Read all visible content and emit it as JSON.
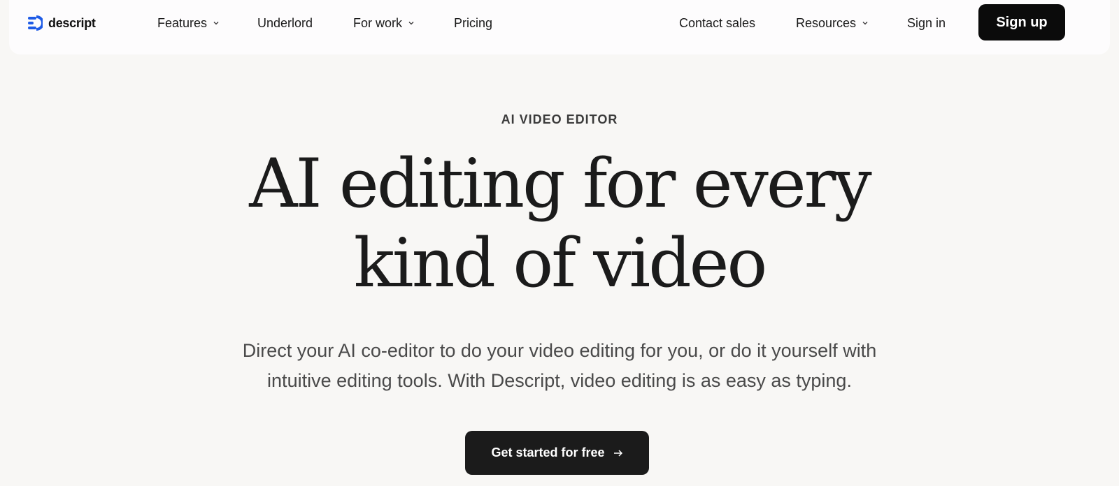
{
  "brand": {
    "name": "descript",
    "color": "#1e5be6"
  },
  "nav": {
    "features": "Features",
    "underlord": "Underlord",
    "for_work": "For work",
    "pricing": "Pricing",
    "contact_sales": "Contact sales",
    "resources": "Resources",
    "sign_in": "Sign in",
    "sign_up": "Sign up"
  },
  "hero": {
    "eyebrow": "AI VIDEO EDITOR",
    "headline_line1": "AI editing for every",
    "headline_line2": "kind of video",
    "subtitle_line1": "Direct your AI co-editor to do your video editing for you, or do it yourself with",
    "subtitle_line2": "intuitive editing tools. With Descript, video editing is as easy as typing.",
    "cta": "Get started for free"
  },
  "icons": {
    "logo": "descript-logo-icon",
    "chevron": "chevron-down-icon",
    "arrow": "arrow-right-icon"
  }
}
